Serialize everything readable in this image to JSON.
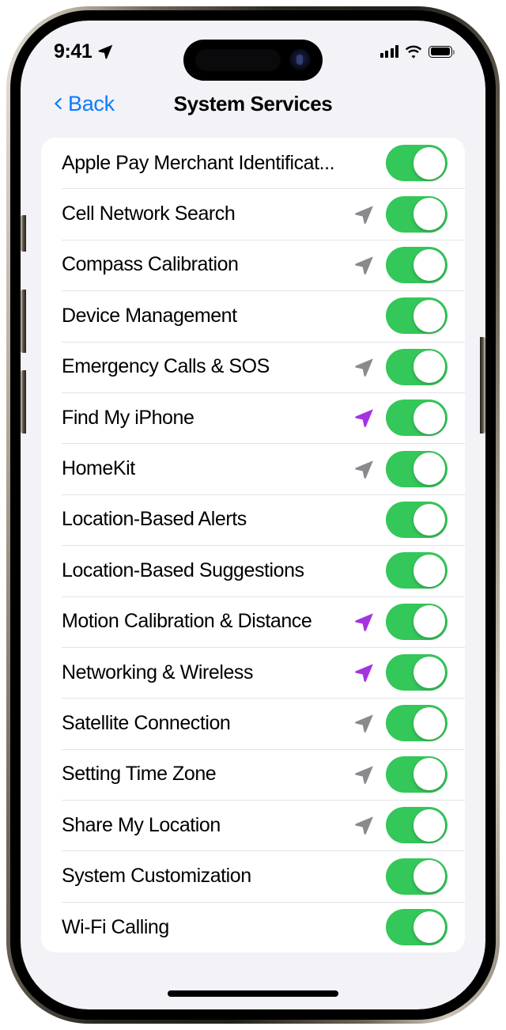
{
  "status_bar": {
    "time": "9:41",
    "location_arrow_icon": "location-arrow-icon",
    "cellular_icon": "cellular-signal-icon",
    "wifi_icon": "wifi-icon",
    "battery_icon": "battery-full-icon"
  },
  "nav": {
    "back_label": "Back",
    "back_icon": "chevron-left-icon",
    "title": "System Services"
  },
  "colors": {
    "accent_blue": "#0A7CFF",
    "toggle_green": "#34C759",
    "arrow_purple": "#A533E0",
    "arrow_gray": "#8A8A8E",
    "page_background": "#F2F2F7",
    "card_background": "#FFFFFF",
    "separator": "#E4E4E8"
  },
  "rows": [
    {
      "label": "Apple Pay Merchant Identificat...",
      "arrow": "none",
      "toggle": "on"
    },
    {
      "label": "Cell Network Search",
      "arrow": "gray",
      "toggle": "on"
    },
    {
      "label": "Compass Calibration",
      "arrow": "gray",
      "toggle": "on"
    },
    {
      "label": "Device Management",
      "arrow": "none",
      "toggle": "on"
    },
    {
      "label": "Emergency Calls & SOS",
      "arrow": "gray",
      "toggle": "on"
    },
    {
      "label": "Find My iPhone",
      "arrow": "purple",
      "toggle": "on"
    },
    {
      "label": "HomeKit",
      "arrow": "gray",
      "toggle": "on"
    },
    {
      "label": "Location-Based Alerts",
      "arrow": "none",
      "toggle": "on"
    },
    {
      "label": "Location-Based Suggestions",
      "arrow": "none",
      "toggle": "on"
    },
    {
      "label": "Motion Calibration & Distance",
      "arrow": "purple",
      "toggle": "on"
    },
    {
      "label": "Networking & Wireless",
      "arrow": "purple",
      "toggle": "on"
    },
    {
      "label": "Satellite Connection",
      "arrow": "gray",
      "toggle": "on"
    },
    {
      "label": "Setting Time Zone",
      "arrow": "gray",
      "toggle": "on"
    },
    {
      "label": "Share My Location",
      "arrow": "gray",
      "toggle": "on"
    },
    {
      "label": "System Customization",
      "arrow": "none",
      "toggle": "on"
    },
    {
      "label": "Wi-Fi Calling",
      "arrow": "none",
      "toggle": "on"
    }
  ]
}
